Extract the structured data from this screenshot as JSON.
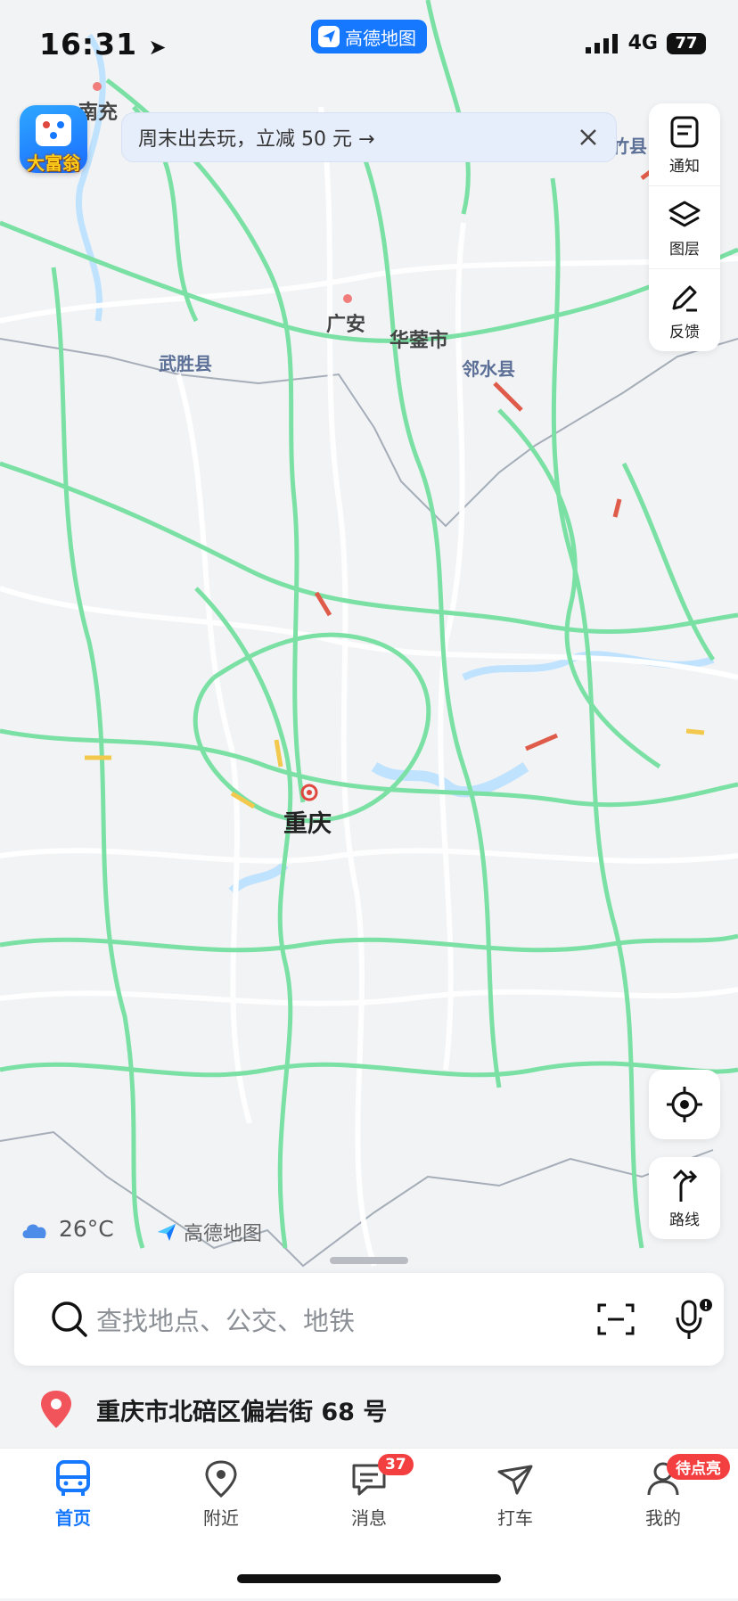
{
  "status_bar": {
    "time": "16:31",
    "app_pill": "高德地图",
    "network": "4G",
    "battery": "77"
  },
  "promo": {
    "text": "周末出去玩，立减 50 元 →"
  },
  "game_icon": {
    "label": "大富翁"
  },
  "side_panel": {
    "notice": "通知",
    "layers": "图层",
    "feedback": "反馈"
  },
  "route_button": {
    "label": "路线"
  },
  "map_labels": {
    "nanchong": "南充",
    "zhuxian": "竹县",
    "guangan": "广安",
    "huayingshi": "华蓥市",
    "wushengxian": "武胜县",
    "linshuixian": "邻水县",
    "chongqing": "重庆"
  },
  "weather": {
    "temp": "26°C"
  },
  "brand": {
    "name": "高德地图"
  },
  "search": {
    "placeholder": "查找地点、公交、地铁"
  },
  "location": {
    "address": "重庆市北碚区偏岩街 68 号"
  },
  "tabbar": {
    "tabs": [
      {
        "label": "首页"
      },
      {
        "label": "附近"
      },
      {
        "label": "消息"
      },
      {
        "label": "打车"
      },
      {
        "label": "我的"
      }
    ],
    "message_badge": "37",
    "mine_badge": "待点亮"
  },
  "colors": {
    "accent": "#1677ff",
    "road": "#7be0a4",
    "water": "#bfe2ff",
    "badge": "#f33f3f"
  }
}
